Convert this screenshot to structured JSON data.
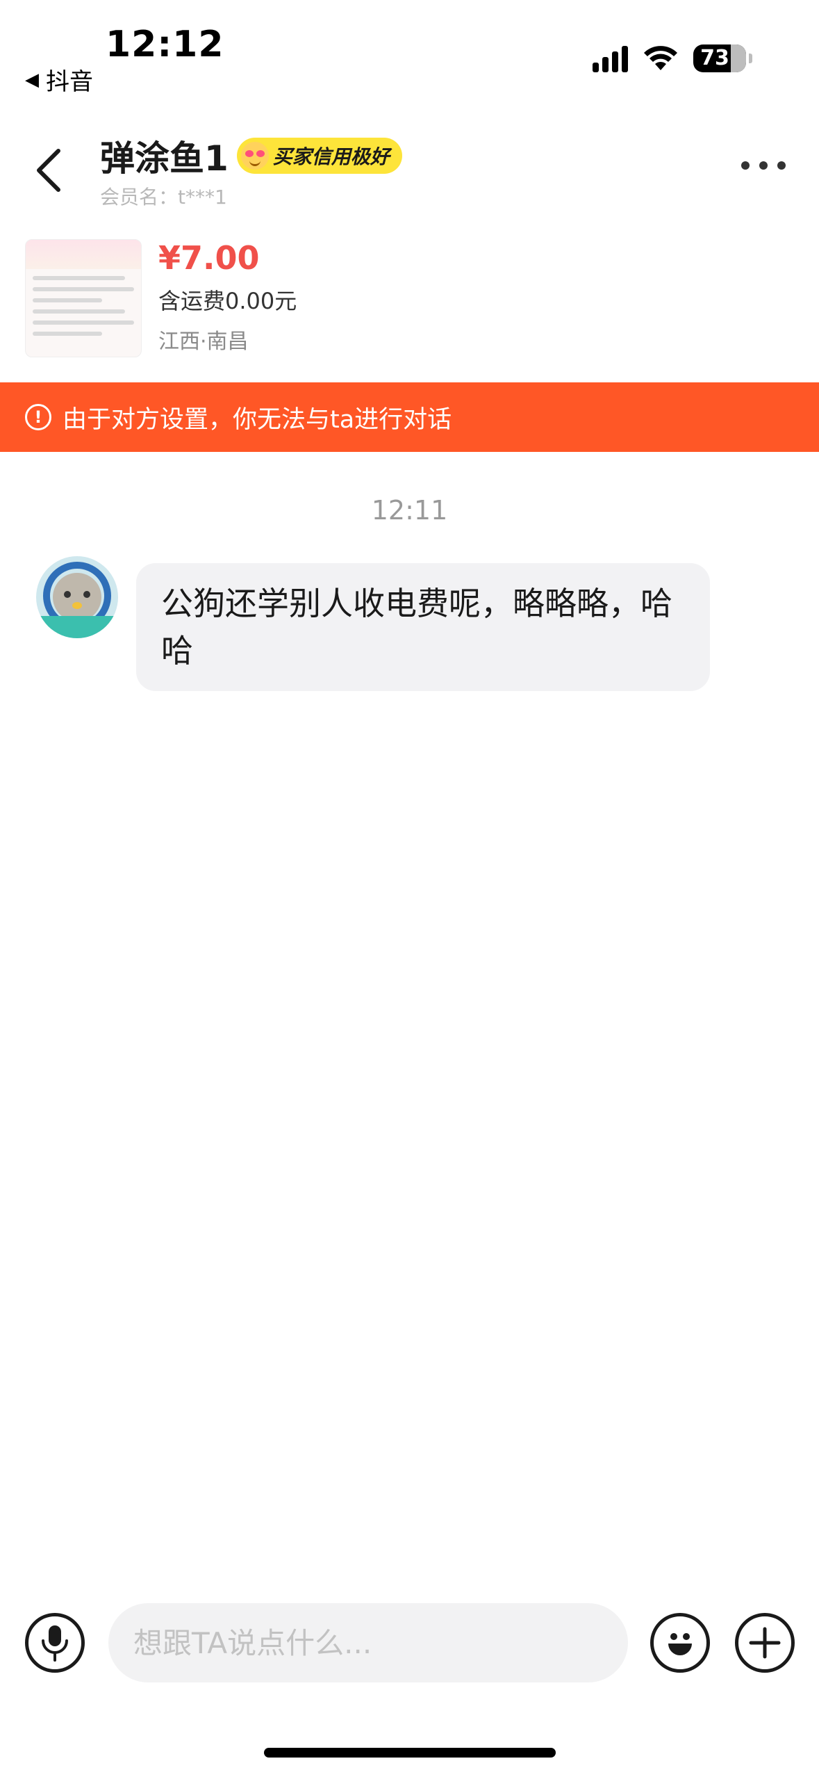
{
  "status_bar": {
    "time": "12:12",
    "back_app": "抖音",
    "battery": "73"
  },
  "header": {
    "title": "弹涂鱼1",
    "credit_badge": "买家信用极好",
    "member_name": "会员名：t***1"
  },
  "product": {
    "price": "¥7.00",
    "shipping": "含运费0.00元",
    "location": "江西·南昌"
  },
  "notice": {
    "text": "由于对方设置，你无法与ta进行对话"
  },
  "chat": {
    "timestamp": "12:11",
    "messages": [
      {
        "text": "公狗还学别人收电费呢，略略略，哈哈"
      }
    ]
  },
  "input": {
    "placeholder": "想跟TA说点什么..."
  },
  "colors": {
    "accent": "#ff5726",
    "price": "#f0504a",
    "badge": "#fde43a",
    "bubble": "#f2f2f4"
  },
  "icons": [
    "back-icon",
    "more-icon",
    "alert-icon",
    "mic-icon",
    "emoji-icon",
    "plus-icon",
    "signal-icon",
    "wifi-icon",
    "battery-icon"
  ]
}
